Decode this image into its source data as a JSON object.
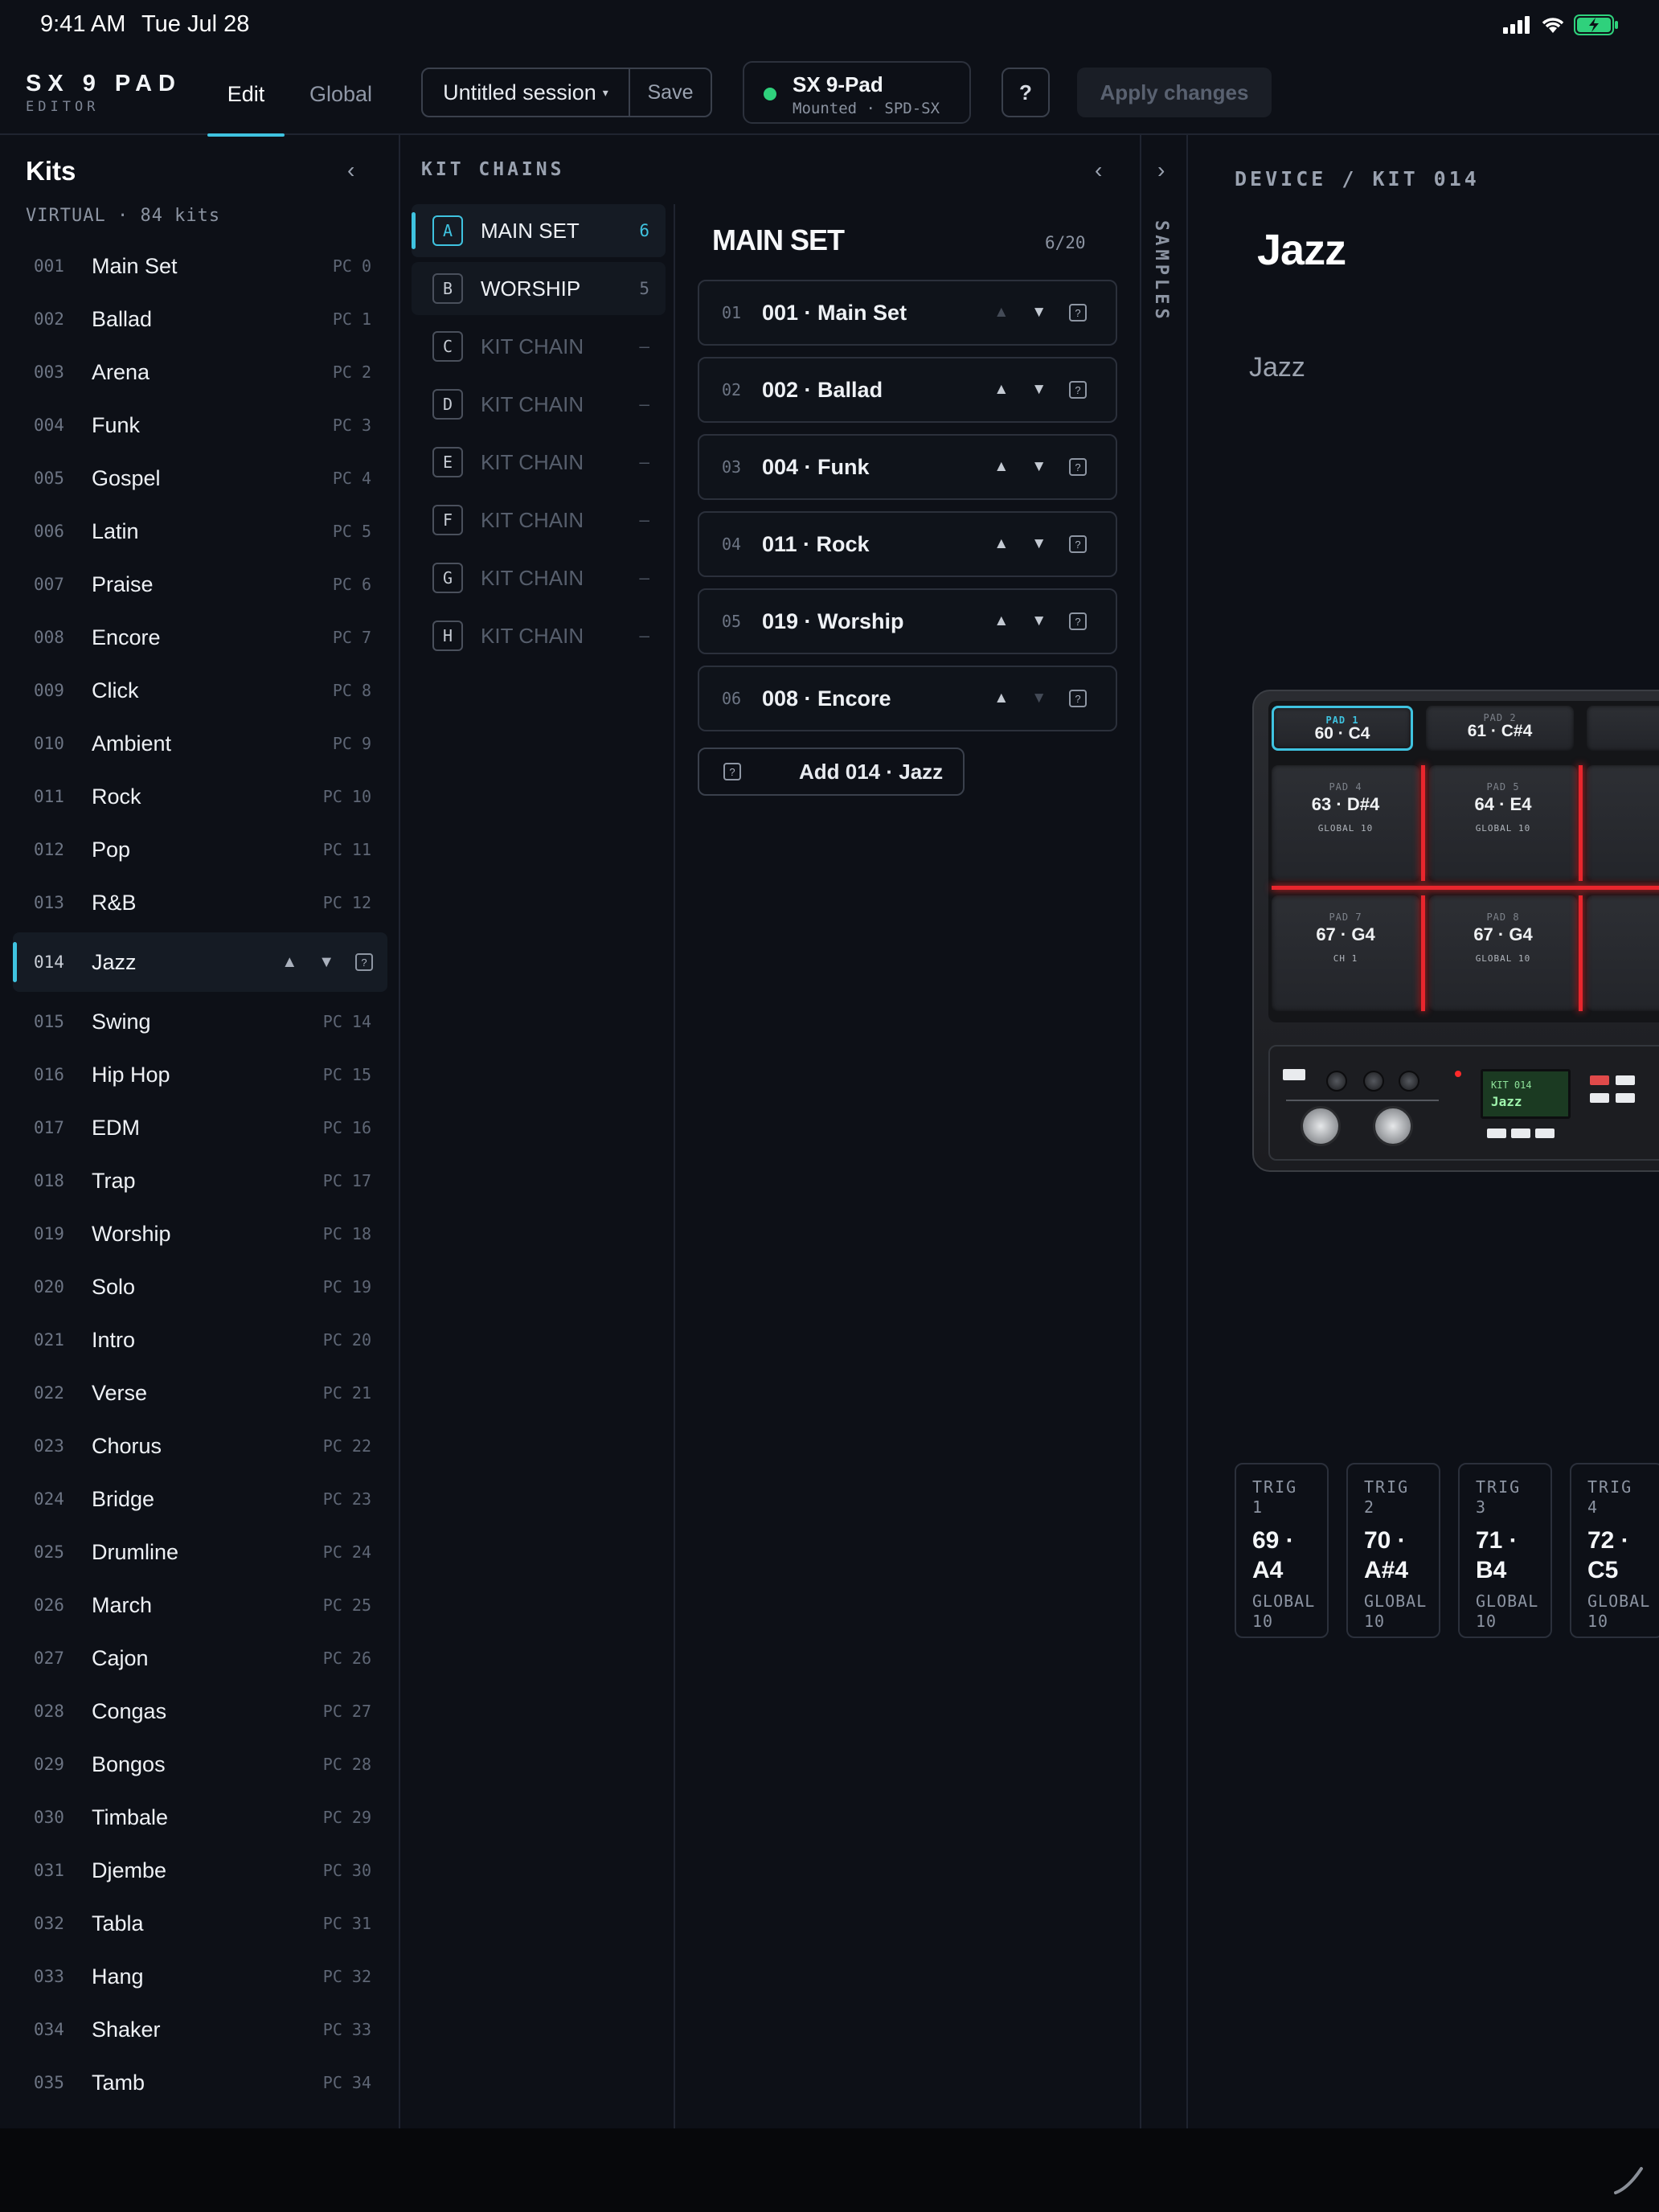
{
  "status_bar": {
    "time": "9:41 AM",
    "date": "Tue Jul 28"
  },
  "brand": {
    "name": "SX 9 PAD",
    "subtitle": "EDITOR"
  },
  "tabs": [
    {
      "label": "Edit",
      "active": true
    },
    {
      "label": "Global",
      "active": false
    }
  ],
  "session": {
    "name": "Untitled session",
    "save_label": "Save"
  },
  "device": {
    "name": "SX 9-Pad",
    "status": "Mounted · SPD-SX",
    "status_color": "#2fd17c"
  },
  "help_label": "?",
  "apply_label": "Apply changes",
  "kits_panel": {
    "title": "Kits",
    "subtitle": "VIRTUAL · 84 kits",
    "items": [
      {
        "num": "001",
        "name": "Main Set",
        "pc": "PC 0"
      },
      {
        "num": "002",
        "name": "Ballad",
        "pc": "PC 1"
      },
      {
        "num": "003",
        "name": "Arena",
        "pc": "PC 2"
      },
      {
        "num": "004",
        "name": "Funk",
        "pc": "PC 3"
      },
      {
        "num": "005",
        "name": "Gospel",
        "pc": "PC 4"
      },
      {
        "num": "006",
        "name": "Latin",
        "pc": "PC 5"
      },
      {
        "num": "007",
        "name": "Praise",
        "pc": "PC 6"
      },
      {
        "num": "008",
        "name": "Encore",
        "pc": "PC 7"
      },
      {
        "num": "009",
        "name": "Click",
        "pc": "PC 8"
      },
      {
        "num": "010",
        "name": "Ambient",
        "pc": "PC 9"
      },
      {
        "num": "011",
        "name": "Rock",
        "pc": "PC 10"
      },
      {
        "num": "012",
        "name": "Pop",
        "pc": "PC 11"
      },
      {
        "num": "013",
        "name": "R&B",
        "pc": "PC 12"
      },
      {
        "num": "014",
        "name": "Jazz",
        "pc": "",
        "selected": true
      },
      {
        "num": "015",
        "name": "Swing",
        "pc": "PC 14"
      },
      {
        "num": "016",
        "name": "Hip Hop",
        "pc": "PC 15"
      },
      {
        "num": "017",
        "name": "EDM",
        "pc": "PC 16"
      },
      {
        "num": "018",
        "name": "Trap",
        "pc": "PC 17"
      },
      {
        "num": "019",
        "name": "Worship",
        "pc": "PC 18"
      },
      {
        "num": "020",
        "name": "Solo",
        "pc": "PC 19"
      },
      {
        "num": "021",
        "name": "Intro",
        "pc": "PC 20"
      },
      {
        "num": "022",
        "name": "Verse",
        "pc": "PC 21"
      },
      {
        "num": "023",
        "name": "Chorus",
        "pc": "PC 22"
      },
      {
        "num": "024",
        "name": "Bridge",
        "pc": "PC 23"
      },
      {
        "num": "025",
        "name": "Drumline",
        "pc": "PC 24"
      },
      {
        "num": "026",
        "name": "March",
        "pc": "PC 25"
      },
      {
        "num": "027",
        "name": "Cajon",
        "pc": "PC 26"
      },
      {
        "num": "028",
        "name": "Congas",
        "pc": "PC 27"
      },
      {
        "num": "029",
        "name": "Bongos",
        "pc": "PC 28"
      },
      {
        "num": "030",
        "name": "Timbale",
        "pc": "PC 29"
      },
      {
        "num": "031",
        "name": "Djembe",
        "pc": "PC 30"
      },
      {
        "num": "032",
        "name": "Tabla",
        "pc": "PC 31"
      },
      {
        "num": "033",
        "name": "Hang",
        "pc": "PC 32"
      },
      {
        "num": "034",
        "name": "Shaker",
        "pc": "PC 33"
      },
      {
        "num": "035",
        "name": "Tamb",
        "pc": "PC 34"
      }
    ]
  },
  "chains_panel": {
    "title": "KIT CHAINS",
    "chains": [
      {
        "letter": "A",
        "name": "MAIN SET",
        "count": "6",
        "state": "selected"
      },
      {
        "letter": "B",
        "name": "WORSHIP",
        "count": "5",
        "state": "filled"
      },
      {
        "letter": "C",
        "name": "KIT CHAIN",
        "count": "–",
        "state": "empty"
      },
      {
        "letter": "D",
        "name": "KIT CHAIN",
        "count": "–",
        "state": "empty"
      },
      {
        "letter": "E",
        "name": "KIT CHAIN",
        "count": "–",
        "state": "empty"
      },
      {
        "letter": "F",
        "name": "KIT CHAIN",
        "count": "–",
        "state": "empty"
      },
      {
        "letter": "G",
        "name": "KIT CHAIN",
        "count": "–",
        "state": "empty"
      },
      {
        "letter": "H",
        "name": "KIT CHAIN",
        "count": "–",
        "state": "empty"
      }
    ],
    "set_title": "MAIN SET",
    "set_count": "6/20",
    "slots": [
      {
        "num": "01",
        "name": "001 · Main Set",
        "up_disabled": true,
        "down_disabled": false
      },
      {
        "num": "02",
        "name": "002 · Ballad",
        "up_disabled": false,
        "down_disabled": false
      },
      {
        "num": "03",
        "name": "004 · Funk",
        "up_disabled": false,
        "down_disabled": false
      },
      {
        "num": "04",
        "name": "011 · Rock",
        "up_disabled": false,
        "down_disabled": false
      },
      {
        "num": "05",
        "name": "019 · Worship",
        "up_disabled": false,
        "down_disabled": false
      },
      {
        "num": "06",
        "name": "008 · Encore",
        "up_disabled": false,
        "down_disabled": true
      }
    ],
    "add_label": "Add 014 · Jazz"
  },
  "samples_label": "SAMPLES",
  "main_panel": {
    "breadcrumb": "DEVICE / KIT 014",
    "kit_title": "Jazz",
    "kit_name_value": "Jazz",
    "device_pads": [
      {
        "label": "PAD 1",
        "note": "60 · C4",
        "channel": "",
        "selected": true
      },
      {
        "label": "PAD 2",
        "note": "61 · C#4",
        "channel": ""
      },
      {
        "label": "PAD 4",
        "note": "63 · D#4",
        "channel": "GLOBAL 10"
      },
      {
        "label": "PAD 5",
        "note": "64 · E4",
        "channel": "GLOBAL 10"
      },
      {
        "label": "PAD 7",
        "note": "67 · G4",
        "channel": "CH 1"
      },
      {
        "label": "PAD 8",
        "note": "67 · G4",
        "channel": "GLOBAL 10"
      }
    ],
    "lcd": {
      "line1": "KIT 014",
      "line2": "Jazz"
    },
    "triggers": [
      {
        "label": "TRIG 1",
        "note": "69 · A4",
        "channel": "GLOBAL 10"
      },
      {
        "label": "TRIG 2",
        "note": "70 · A#4",
        "channel": "GLOBAL 10"
      },
      {
        "label": "TRIG 3",
        "note": "71 · B4",
        "channel": "GLOBAL 10"
      },
      {
        "label": "TRIG 4",
        "note": "72 · C5",
        "channel": "GLOBAL 10"
      }
    ]
  },
  "colors": {
    "accent": "#3fc3e0",
    "pad_glow": "#e8262d",
    "connected": "#2fd17c"
  }
}
